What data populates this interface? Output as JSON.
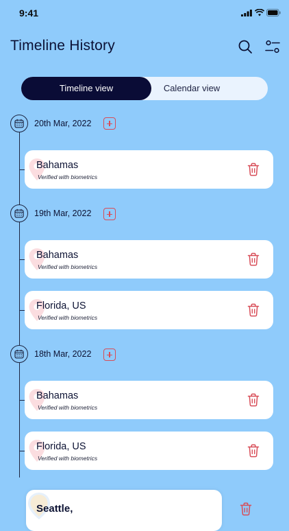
{
  "status_bar": {
    "time": "9:41"
  },
  "header": {
    "title": "Timeline History"
  },
  "tabs": {
    "active": "Timeline view",
    "inactive": "Calendar view"
  },
  "groups": [
    {
      "date": "20th Mar, 2022",
      "entries": [
        {
          "location": "Bahamas",
          "subtitle": "Verified with biometrics"
        }
      ]
    },
    {
      "date": "19th Mar, 2022",
      "entries": [
        {
          "location": "Bahamas",
          "subtitle": "Verified with biometrics"
        },
        {
          "location": "Florida, US",
          "subtitle": "Verified with biometrics"
        }
      ]
    },
    {
      "date": "18th Mar, 2022",
      "entries": [
        {
          "location": "Bahamas",
          "subtitle": "Verified with biometrics"
        },
        {
          "location": "Florida, US",
          "subtitle": "Verified with biometrics"
        }
      ]
    }
  ],
  "partial_entry": {
    "location": "Seattle,"
  },
  "colors": {
    "background": "#8fcbfb",
    "accent_dark": "#0a0c36",
    "danger": "#d84c57",
    "card": "#ffffff"
  }
}
